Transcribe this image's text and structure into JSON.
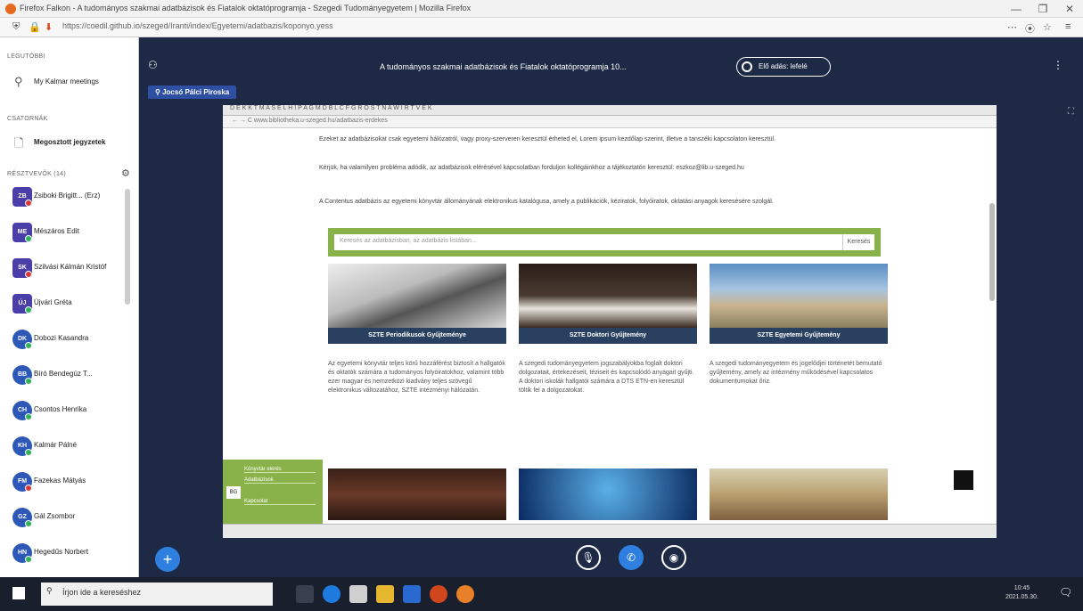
{
  "browser": {
    "title": "Firefox Falkon - A tudományos szakmai adatbázisok és Fiatalok oktatóprogramja - Szegedi Tudományegyetem | Mozilla Firefox",
    "url": "https://coedil.github.io/szeged/Iranti/index/Egyetemi/adatbazis/koponyo.yess",
    "window_buttons": [
      "—",
      "❐",
      "✕"
    ]
  },
  "sidebar": {
    "section_recent": "LEGUTÓBBI",
    "item_recent": "My Kalmar meetings",
    "section_channels": "CSATORNÁK",
    "item_notes": "Megosztott jegyzetek",
    "section_participants": "RÉSZTVEVŐK (14)",
    "participants": [
      {
        "initials": "ZB",
        "name": "Zsiboki Brigitt... (Erz)",
        "status": "red",
        "shape": "sq"
      },
      {
        "initials": "ME",
        "name": "Mészáros Edit",
        "status": "grn",
        "shape": "sq"
      },
      {
        "initials": "SK",
        "name": "Szilvási Kálmán Kristóf",
        "status": "red",
        "shape": "sq"
      },
      {
        "initials": "ÚJ",
        "name": "Újvári Gréta",
        "status": "grn",
        "shape": "sq"
      },
      {
        "initials": "DK",
        "name": "Dobozi Kasandra",
        "status": "grn",
        "shape": "circ"
      },
      {
        "initials": "BB",
        "name": "Bíró Bendegúz T...",
        "status": "grn",
        "shape": "circ"
      },
      {
        "initials": "CH",
        "name": "Csontos Henrika",
        "status": "grn",
        "shape": "circ"
      },
      {
        "initials": "KH",
        "name": "Kalmár Pálné",
        "status": "grn",
        "shape": "circ"
      },
      {
        "initials": "FM",
        "name": "Fazekas Mátyás",
        "status": "red",
        "shape": "circ"
      },
      {
        "initials": "GZ",
        "name": "Gál Zsombor",
        "status": "grn",
        "shape": "circ"
      },
      {
        "initials": "HN",
        "name": "Hegedűs Norbert",
        "status": "grn",
        "shape": "circ"
      }
    ]
  },
  "meeting": {
    "title": "A tudományos szakmai adatbázisok és Fiatalok oktatóprogramja 10...",
    "live_label": "Elő adás: lefelé",
    "presenter": "Jocsó Pálci Piroska"
  },
  "shared": {
    "toolbar_text": "D  E  K  K  T  M  A  S  E  L  H  I  P  A  G  M  D  B  L  C  F  G  R  O  S  T  N  A  W  I  R  T  V  E  K",
    "inner_url": "←  →  C   www.bibliotheka.u-szeged.hu/adatbazis-erdekes",
    "para1": "Ezeket az adatbázisokat csak egyetemi hálózatról, vagy proxy-szerveren keresztül érheted el, Lorem ipsum kezdőlap szerint, illetve a tanszéki kapcsolaton keresztül.",
    "para2": "Kérjük, ha valamilyen probléma adódik, az adatbázisok elérésével kapcsolatban forduljon kollégáinkhoz a tájékoztatón keresztül: eszkoz@lib.u-szeged.hu",
    "para3": "A Contentus adatbázis az egyetemi könyvtár állományának elektronikus katalógusa, amely a publikációk, kéziratok, folyóiratok, oktatási anyagok keresésére szolgál.",
    "search_placeholder": "Keresés az adatbázisban, az adatbázis listában...",
    "search_button": "Keresés",
    "cards": [
      {
        "caption": "SZTE Periodikusok Gyűjteménye",
        "text": "Az egyetemi könyvtár teljes körű hozzáférést biztosít a hallgatók és oktatók számára a tudományos folyóiratokhoz, valamint több ezer magyar és nemzetközi kiadvány teljes szövegű elektronikus változatához, SZTE intézményi hálózatán."
      },
      {
        "caption": "SZTE Doktori Gyűjtemény",
        "text": "A szegedi tudományegyetem jogszabályokba foglalt doktori dolgozatait, értekezéseit, téziseit és kapcsolódó anyagait gyűjti. A doktori iskolák hallgatói számára a DTS ETN-en keresztül töltik fel a dolgozatokat."
      },
      {
        "caption": "SZTE Egyetemi Gyűjtemény",
        "text": "A szegedi tudományegyetem és jogelődjei történetét bemutató gyűjtemény, amely az intézmény működésével kapcsolatos dokumentumokat őriz."
      }
    ],
    "panel_items": [
      "Könyvtár elérés",
      "Adatbázisok",
      "Kapcsolat"
    ],
    "panel_icon": "BG"
  },
  "taskbar": {
    "search": "Írjon ide a kereséshez",
    "time": "10:45",
    "date": "2021.05.30."
  }
}
